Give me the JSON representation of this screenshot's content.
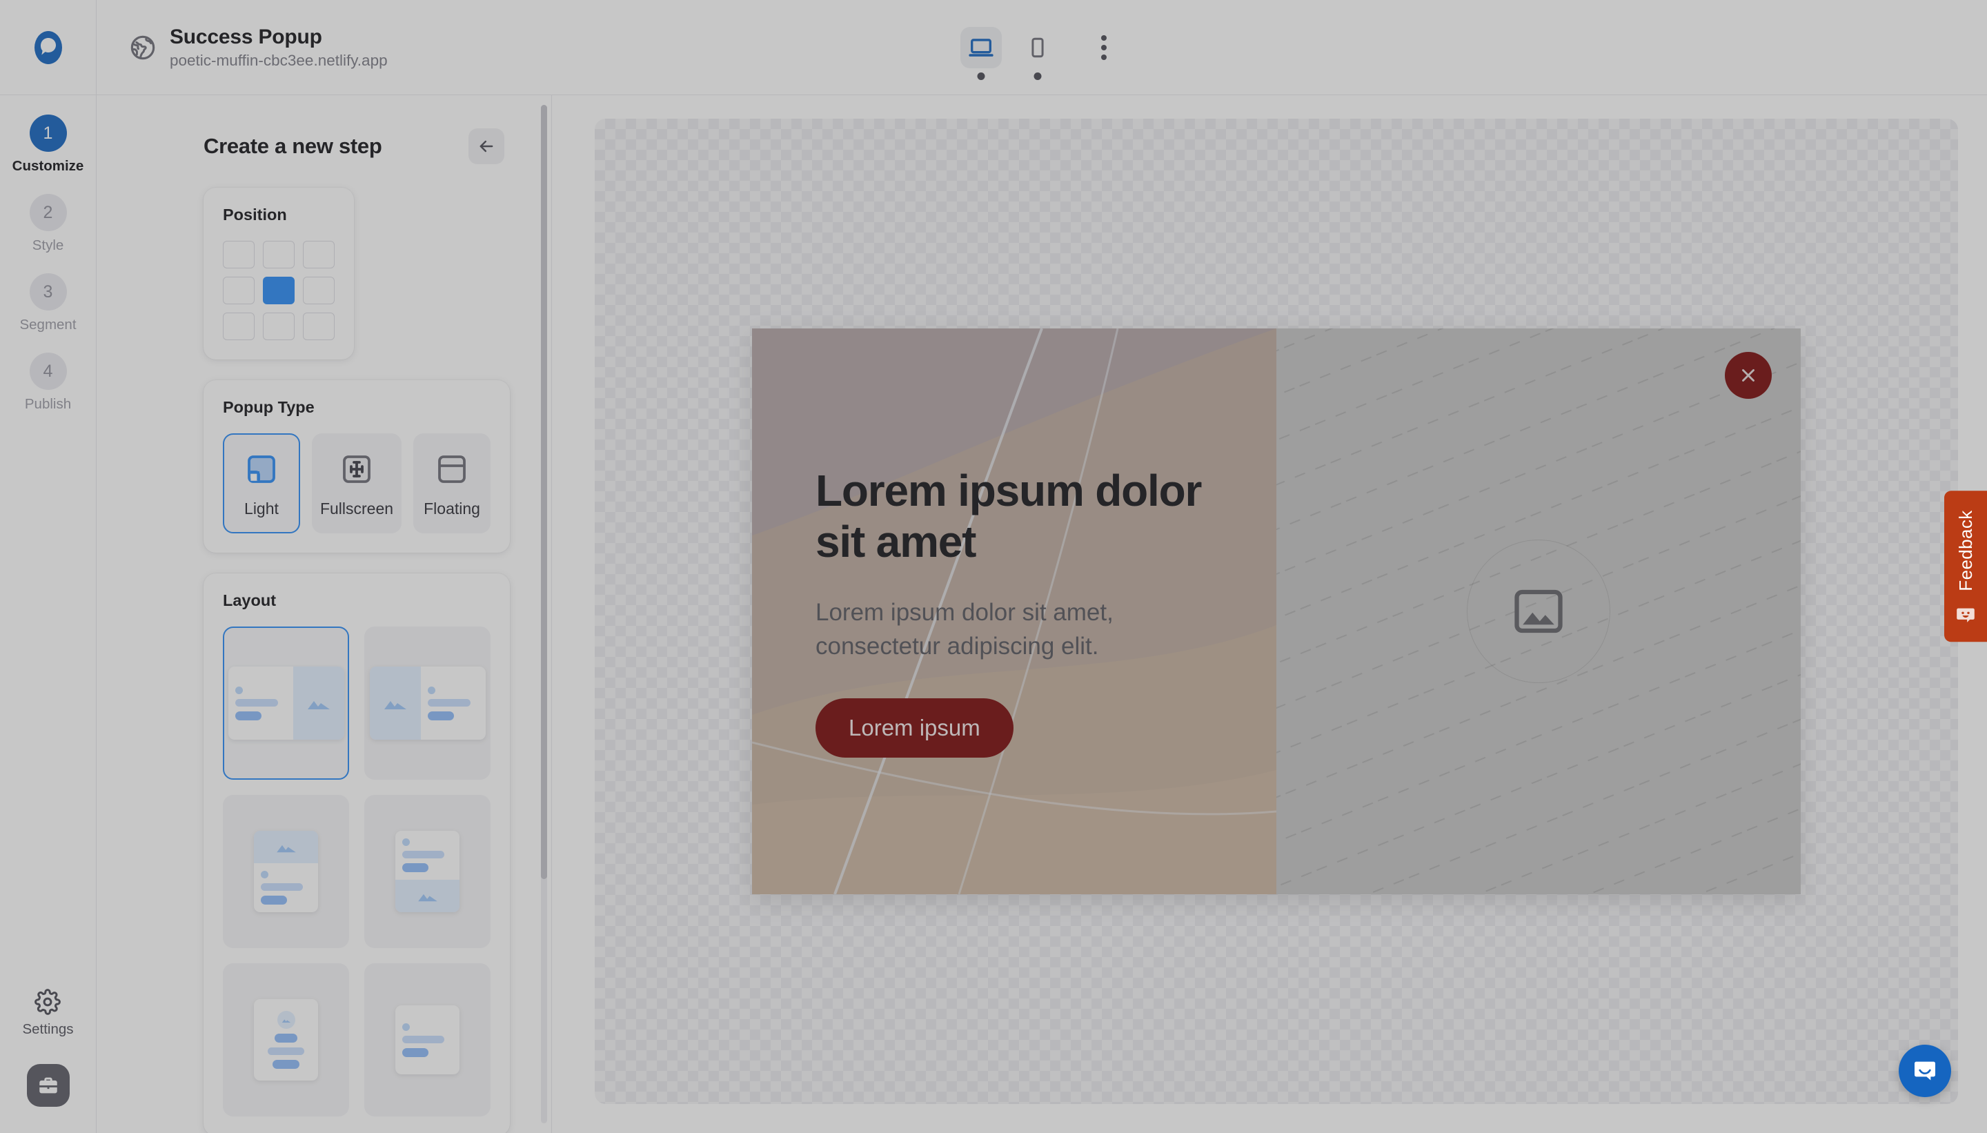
{
  "brand": {
    "logo_icon": "popupsmart-logo-icon",
    "accent_blue": "#1565c0",
    "select_blue": "#2b8cf5"
  },
  "rail": {
    "steps": [
      {
        "number": "1",
        "label": "Customize",
        "active": true
      },
      {
        "number": "2",
        "label": "Style",
        "active": false
      },
      {
        "number": "3",
        "label": "Segment",
        "active": false
      },
      {
        "number": "4",
        "label": "Publish",
        "active": false
      }
    ],
    "settings_label": "Settings",
    "settings_icon": "gear-icon",
    "briefcase_icon": "briefcase-icon"
  },
  "topbar": {
    "site_icon": "globe-icon",
    "site_title": "Success Popup",
    "site_url": "poetic-muffin-cbc3ee.netlify.app",
    "devices": [
      {
        "name": "desktop",
        "icon": "desktop-icon",
        "active": true
      },
      {
        "name": "mobile",
        "icon": "mobile-icon",
        "active": false
      }
    ],
    "more_icon": "kebab-menu-icon"
  },
  "panel": {
    "title": "Create a new step",
    "back_icon": "arrow-left-icon",
    "position": {
      "title": "Position",
      "cells": [
        {
          "name": "top-left",
          "selected": false
        },
        {
          "name": "top-center",
          "selected": false
        },
        {
          "name": "top-right",
          "selected": false
        },
        {
          "name": "middle-left",
          "selected": false
        },
        {
          "name": "middle-center",
          "selected": true
        },
        {
          "name": "middle-right",
          "selected": false
        },
        {
          "name": "bottom-left",
          "selected": false
        },
        {
          "name": "bottom-center",
          "selected": false
        },
        {
          "name": "bottom-right",
          "selected": false
        }
      ]
    },
    "popup_type": {
      "title": "Popup Type",
      "options": [
        {
          "label": "Light",
          "icon": "light-popup-icon",
          "selected": true
        },
        {
          "label": "Fullscreen",
          "icon": "fullscreen-popup-icon",
          "selected": false
        },
        {
          "label": "Floating",
          "icon": "floating-popup-icon",
          "selected": false
        }
      ]
    },
    "layout": {
      "title": "Layout",
      "options": [
        {
          "name": "text-left-image-right",
          "selected": true
        },
        {
          "name": "image-left-text-right",
          "selected": false
        },
        {
          "name": "image-top-text-bottom",
          "selected": false
        },
        {
          "name": "text-top-image-bottom",
          "selected": false
        },
        {
          "name": "centered-icon-text",
          "selected": false
        },
        {
          "name": "text-only",
          "selected": false
        }
      ]
    }
  },
  "preview": {
    "popup": {
      "heading": "Lorem ipsum dolor sit amet",
      "paragraph": "Lorem ipsum dolor sit amet, consectetur adipiscing elit.",
      "cta_label": "Lorem ipsum",
      "cta_color": "#7a0c0c",
      "close_icon": "close-icon",
      "image_placeholder_icon": "image-placeholder-icon"
    }
  },
  "feedback": {
    "label": "Feedback",
    "icon": "feedback-smiley-icon",
    "color": "#bb3c15"
  },
  "intercom": {
    "icon": "chat-bubble-icon",
    "color": "#1565c0"
  }
}
